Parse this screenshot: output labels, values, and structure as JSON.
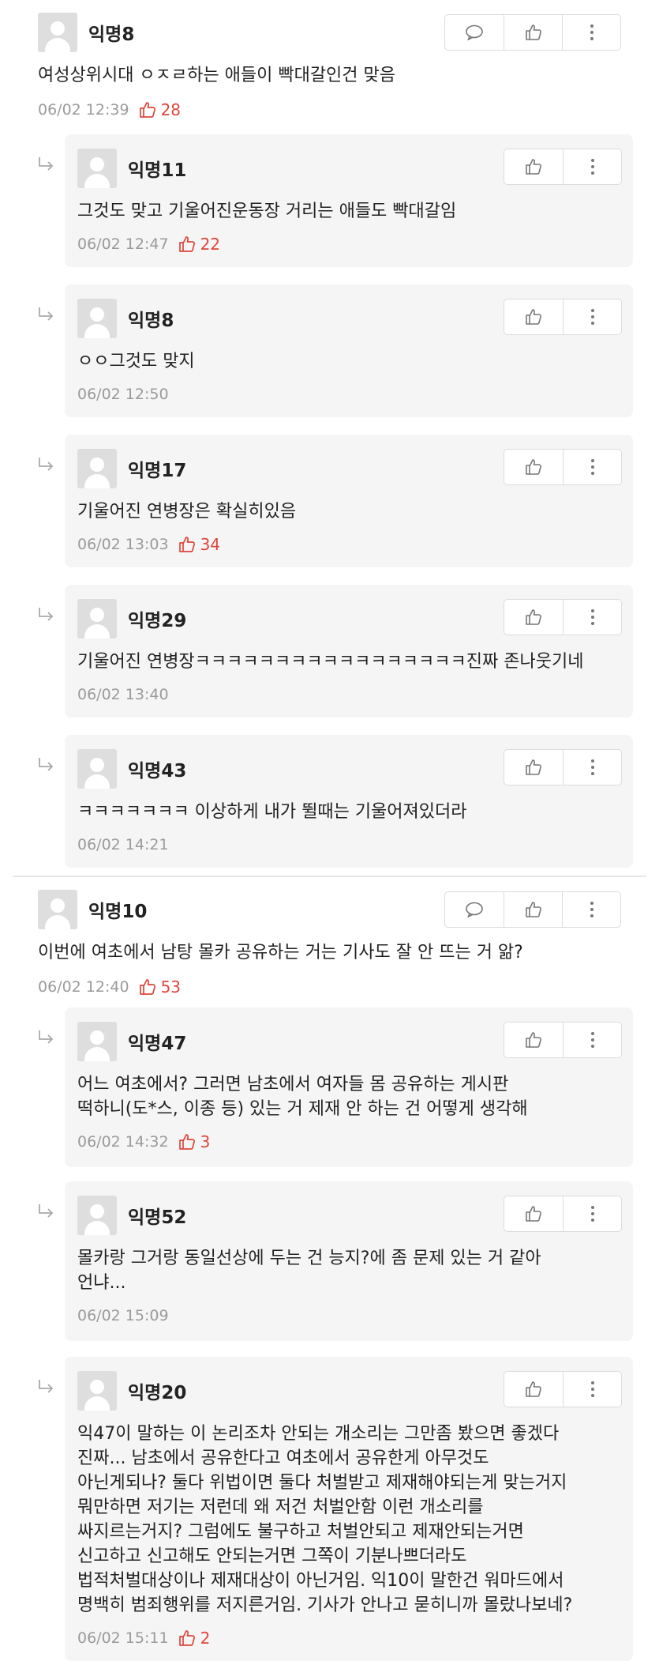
{
  "threads": [
    {
      "comment": {
        "nick": "익명8",
        "body": "여성상위시대 ㅇㅈㄹ하는 애들이 빡대갈인건 맞음",
        "time": "06/02 12:39",
        "likes": "28"
      },
      "replies": [
        {
          "nick": "익명11",
          "body": "그것도 맞고 기울어진운동장 거리는 애들도 빡대갈임",
          "time": "06/02 12:47",
          "likes": "22"
        },
        {
          "nick": "익명8",
          "body": "ㅇㅇ그것도 맞지",
          "time": "06/02 12:50",
          "likes": ""
        },
        {
          "nick": "익명17",
          "body": "기울어진 연병장은 확실히있음",
          "time": "06/02 13:03",
          "likes": "34"
        },
        {
          "nick": "익명29",
          "body": "기울어진 연병장ㅋㅋㅋㅋㅋㅋㅋㅋㅋㅋㅋㅋㅋㅋㅋㅋㅋ진짜 존나웃기네",
          "time": "06/02 13:40",
          "likes": ""
        },
        {
          "nick": "익명43",
          "body": "ㅋㅋㅋㅋㅋㅋㅋ 이상하게 내가 뛸때는 기울어져있더라",
          "time": "06/02 14:21",
          "likes": ""
        }
      ]
    },
    {
      "comment": {
        "nick": "익명10",
        "body": "이번에 여초에서 남탕 몰카 공유하는 거는 기사도 잘 안 뜨는 거 앎?",
        "time": "06/02 12:40",
        "likes": "53"
      },
      "replies": [
        {
          "nick": "익명47",
          "body": "어느 여초에서? 그러면 남초에서 여자들 몸 공유하는 게시판\n떡하니(도*스, 이종 등) 있는 거 제재 안 하는 건 어떻게 생각해",
          "time": "06/02 14:32",
          "likes": "3"
        },
        {
          "nick": "익명52",
          "body": "몰카랑 그거랑 동일선상에 두는 건 능지?에 좀 문제 있는 거 같아\n언냐...",
          "time": "06/02 15:09",
          "likes": ""
        },
        {
          "nick": "익명20",
          "body": "익47이 말하는 이 논리조차 안되는 개소리는 그만좀 봤으면 좋겠다\n진짜... 남초에서 공유한다고 여초에서 공유한게 아무것도\n아닌게되나? 둘다 위법이면 둘다 처벌받고 제재해야되는게 맞는거지\n뭐만하면 저기는 저런데 왜 저건 처벌안함 이런 개소리를\n싸지르는거지? 그럼에도 불구하고 처벌안되고 제재안되는거면\n신고하고 신고해도 안되는거면 그쪽이 기분나쁘더라도\n법적처벌대상이나 제재대상이 아닌거임. 익10이 말한건 워마드에서\n명백히 범죄행위를 저지른거임. 기사가 안나고 묻히니까 몰랐나보네?",
          "time": "06/02 15:11",
          "likes": "2"
        }
      ]
    }
  ],
  "icons": {
    "reply": "speech-bubble-icon",
    "like": "thumbs-up-icon",
    "more": "kebab-menu-icon",
    "nested": "reply-arrow-icon"
  },
  "colors": {
    "likes": "#e0453a",
    "meta": "#9a9a9a",
    "reply_bg": "#f5f5f5"
  }
}
